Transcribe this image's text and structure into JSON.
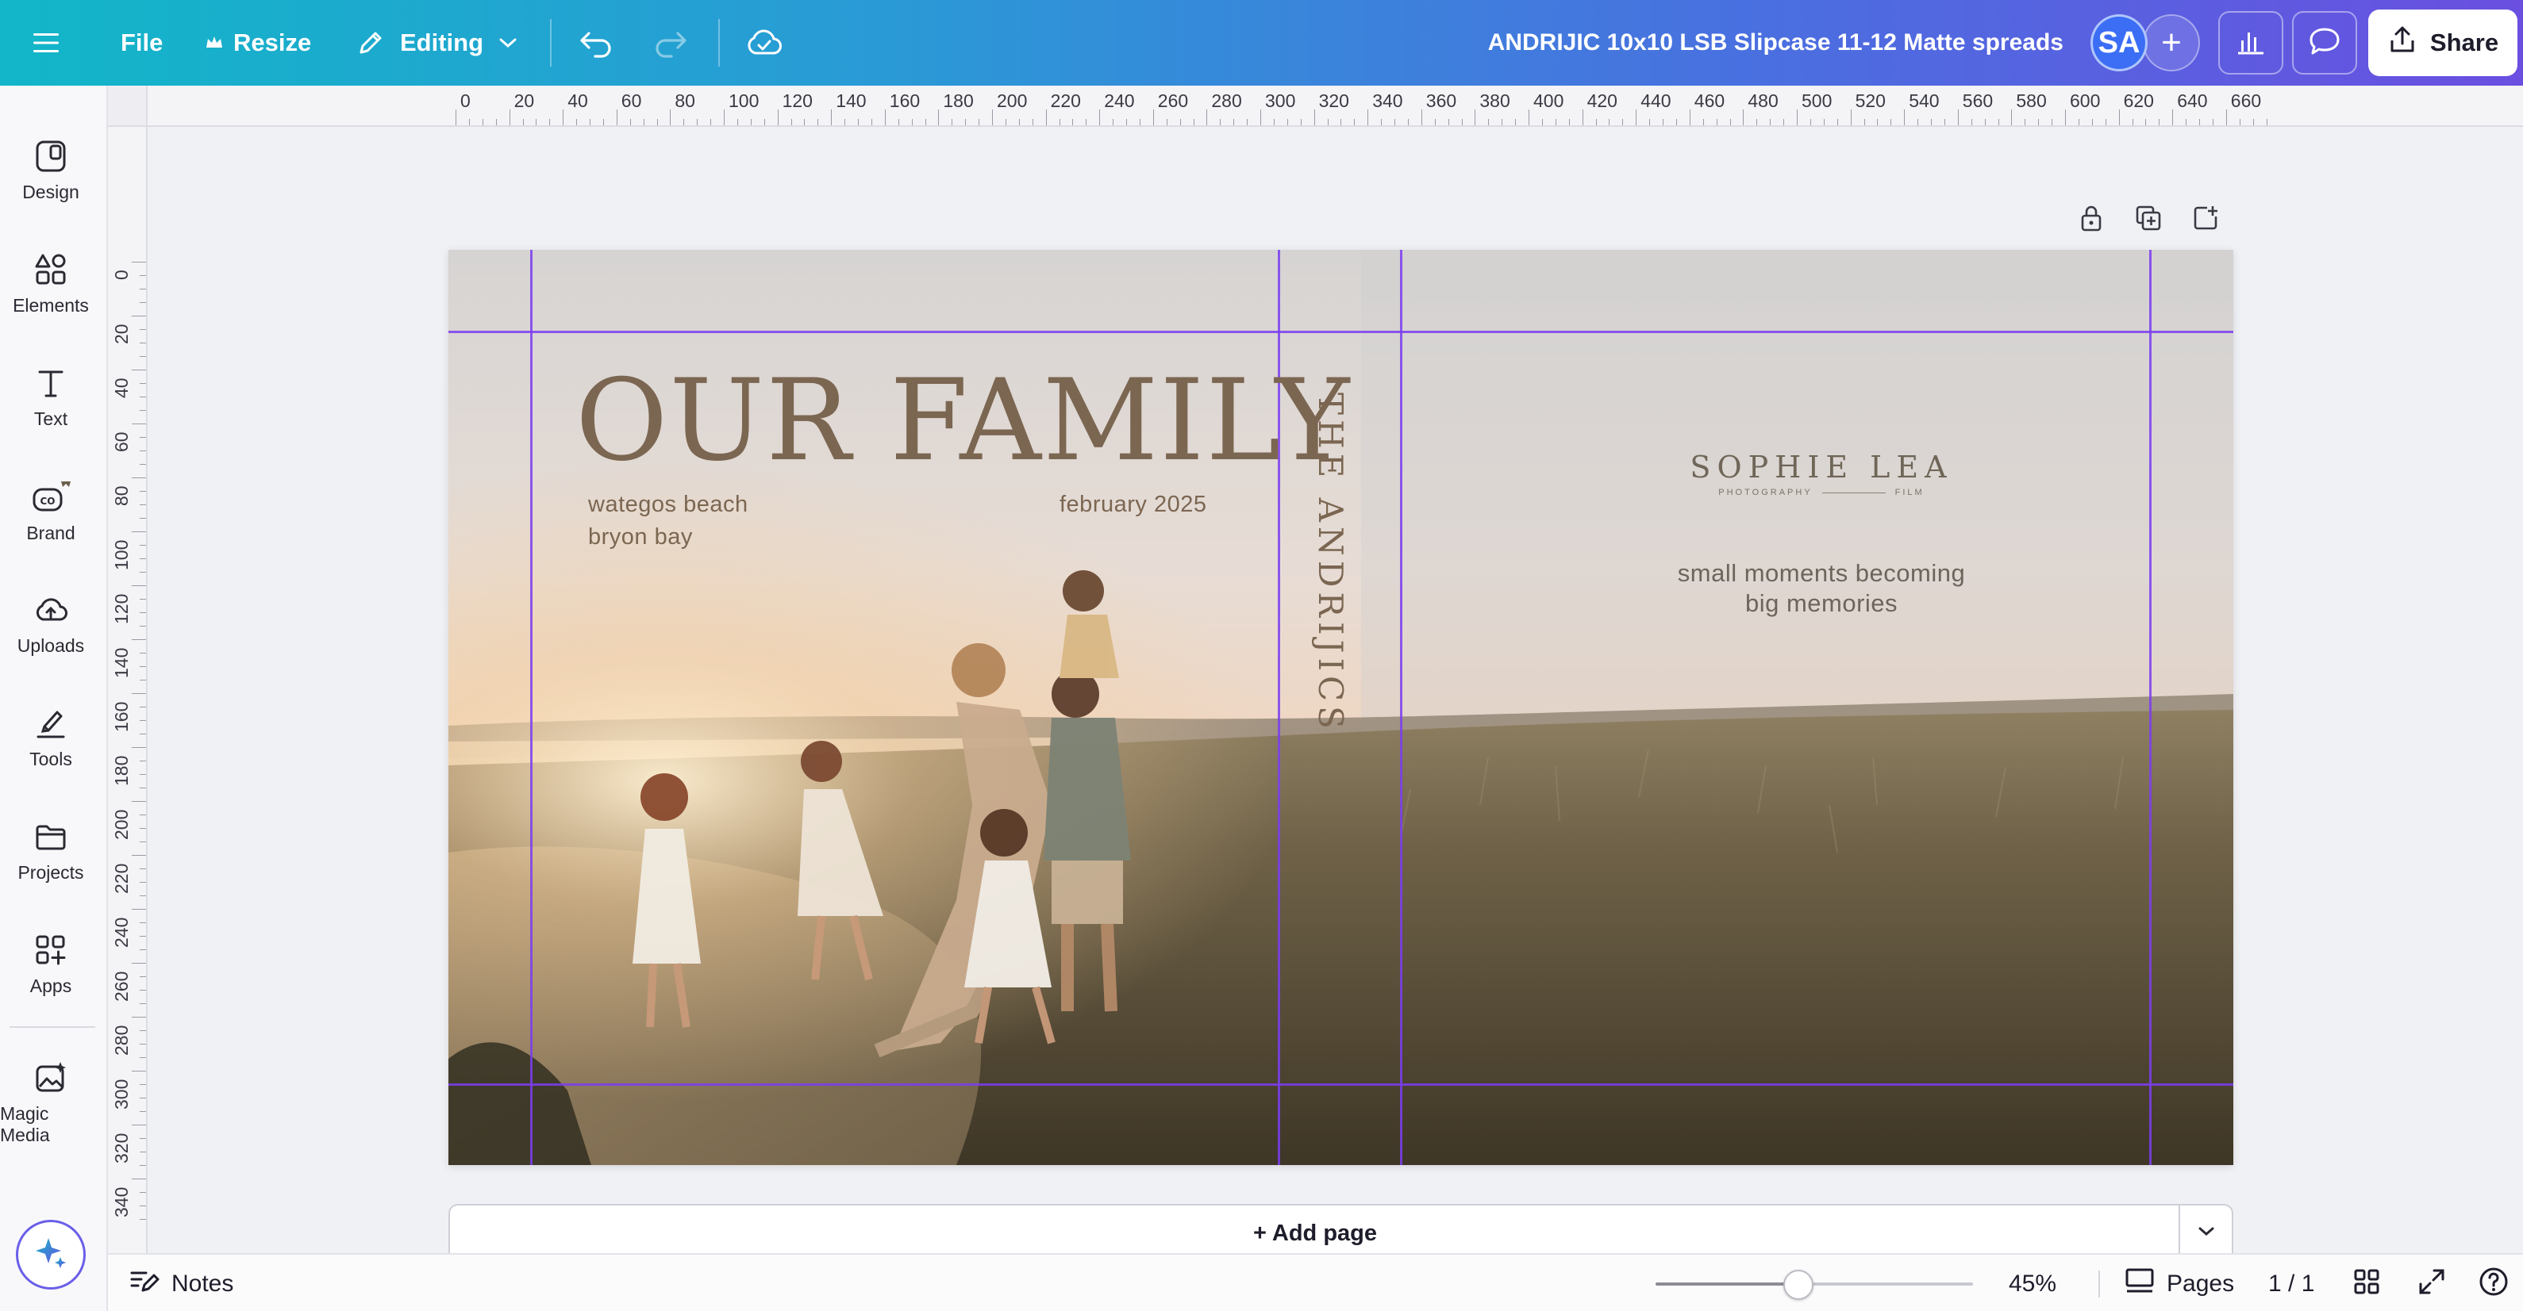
{
  "topbar": {
    "menu_icon": "hamburger-icon",
    "file_label": "File",
    "resize_label": "Resize",
    "editing_label": "Editing",
    "document_title": "ANDRIJIC 10x10 LSB Slipcase 11-12 Matte spreads",
    "avatar_initials": "SA",
    "share_label": "Share",
    "accent_gradient": [
      "#12b6c8",
      "#6a4fe0"
    ]
  },
  "sidebar": {
    "items": [
      {
        "label": "Design",
        "icon": "design-icon"
      },
      {
        "label": "Elements",
        "icon": "elements-icon"
      },
      {
        "label": "Text",
        "icon": "text-icon"
      },
      {
        "label": "Brand",
        "icon": "brand-icon"
      },
      {
        "label": "Uploads",
        "icon": "uploads-icon"
      },
      {
        "label": "Tools",
        "icon": "tools-icon"
      },
      {
        "label": "Projects",
        "icon": "folder-icon"
      },
      {
        "label": "Apps",
        "icon": "apps-icon"
      },
      {
        "label": "Magic Media",
        "icon": "magic-media-icon"
      }
    ]
  },
  "rulers": {
    "top": [
      "0",
      "20",
      "40",
      "60",
      "80",
      "100",
      "120",
      "140",
      "160",
      "180",
      "200",
      "220",
      "240",
      "260",
      "280",
      "300",
      "320",
      "340",
      "360",
      "380",
      "400",
      "420",
      "440",
      "460",
      "480",
      "500",
      "520",
      "540",
      "560",
      "580",
      "600",
      "620",
      "640",
      "660"
    ],
    "left": [
      "0",
      "20",
      "40",
      "60",
      "80",
      "100",
      "120",
      "140",
      "160",
      "180",
      "200",
      "220",
      "240",
      "260",
      "280",
      "300",
      "320",
      "340"
    ]
  },
  "design": {
    "title": "OUR FAMILY",
    "location_line_1": "wategos beach",
    "location_line_2": "bryon bay",
    "date": "february 2025",
    "spine_text": "THE ANDRIJICS",
    "brand_name": "SOPHIE LEA",
    "brand_sub_left": "PHOTOGRAPHY",
    "brand_sub_right": "FILM",
    "tagline_1": "small  moments becoming",
    "tagline_2": "big memories",
    "text_color": "#7b6651",
    "guide_color": "#7b3df0"
  },
  "canvas": {
    "add_page_label": "+ Add page"
  },
  "bottombar": {
    "notes_label": "Notes",
    "zoom_label": "45%",
    "zoom_fraction": 0.45,
    "pages_label": "Pages",
    "page_count": "1 / 1"
  }
}
